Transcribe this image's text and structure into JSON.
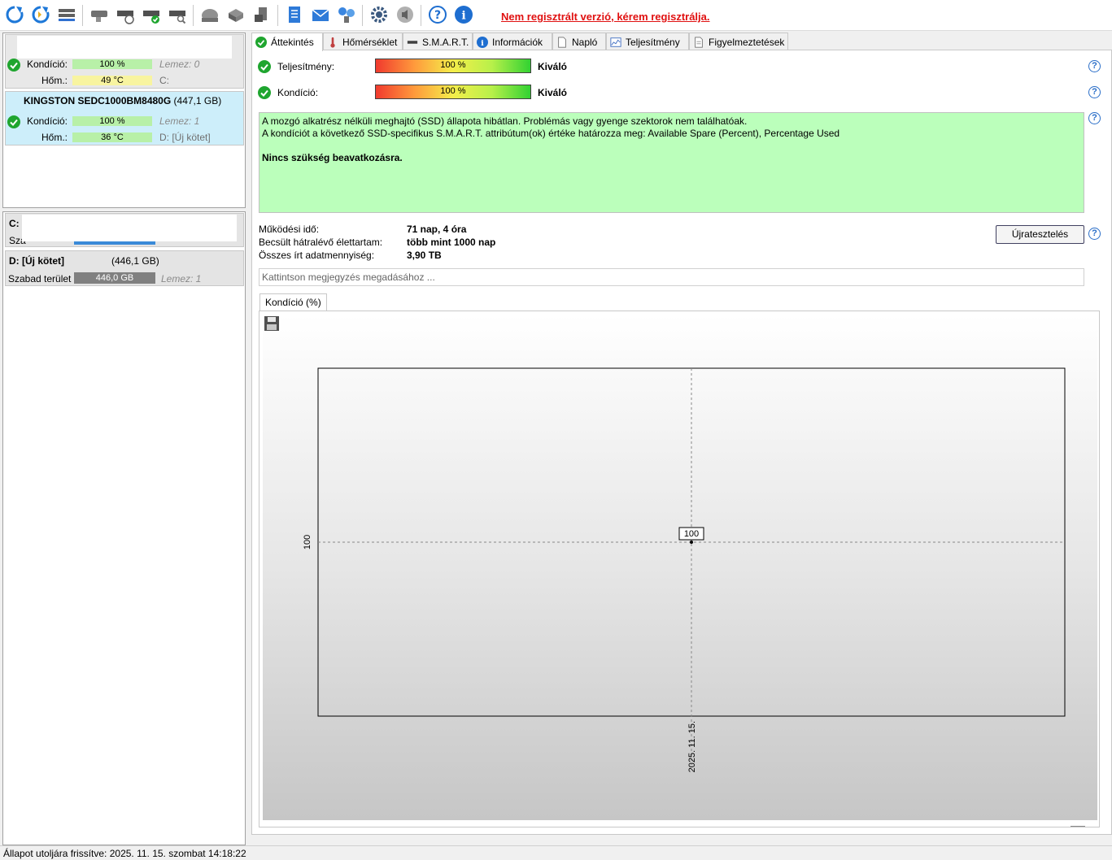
{
  "toolbar": {
    "unregistered_notice": "Nem regisztrált verzió, kérem regisztrálja.",
    "icons": [
      "refresh-icon",
      "refresh-all-icon",
      "drive-list-icon",
      "disk-icon",
      "disk-schedule-icon",
      "disk-check-icon",
      "disk-search-icon",
      "cloud-disk-icon",
      "network-disk-icon",
      "external-disk-icon",
      "notes-icon",
      "mail-icon",
      "network-icon",
      "settings-icon",
      "speaker-icon",
      "help-icon",
      "info-icon"
    ]
  },
  "disks": [
    {
      "condition_label": "Kondíció:",
      "condition_value": "100 %",
      "temp_label": "Hőm.:",
      "temp_value": "49 °C",
      "disk_index": "Lemez: 0",
      "volume": "C:"
    },
    {
      "name": "KINGSTON SEDC1000BM8480G",
      "capacity": "(447,1 GB)",
      "condition_label": "Kondíció:",
      "condition_value": "100 %",
      "temp_label": "Hőm.:",
      "temp_value": "36 °C",
      "disk_index": "Lemez: 1",
      "volume": "D: [Új kötet]"
    }
  ],
  "volumes": [
    {
      "name": "C:",
      "free_label": "Sza"
    },
    {
      "name": "D: [Új kötet]",
      "size": "(446,1 GB)",
      "free_label": "Szabad terület",
      "free_value": "446,0 GB",
      "disk_index": "Lemez: 1"
    }
  ],
  "tabs": [
    {
      "label": "Áttekintés",
      "active": true
    },
    {
      "label": "Hőmérséklet"
    },
    {
      "label": "S.M.A.R.T."
    },
    {
      "label": "Információk"
    },
    {
      "label": "Napló"
    },
    {
      "label": "Teljesítmény"
    },
    {
      "label": "Figyelmeztetések"
    }
  ],
  "overview": {
    "performance_label": "Teljesítmény:",
    "performance_value": "100 %",
    "performance_percent": 100,
    "performance_rating": "Kiváló",
    "condition_label": "Kondíció:",
    "condition_value": "100 %",
    "condition_percent": 100,
    "condition_rating": "Kiváló",
    "status_line1": "A mozgó alkatrész nélküli meghajtó (SSD) állapota hibátlan. Problémás vagy gyenge szektorok nem találhatóak.",
    "status_line2": "A kondíciót a következő SSD-specifikus S.M.A.R.T. attribútum(ok) értéke határozza meg:  Available Spare (Percent), Percentage Used",
    "status_line3": "Nincs szükség beavatkozásra.",
    "uptime_label": "Működési idő:",
    "uptime_value": "71 nap, 4 óra",
    "remaining_label": "Becsült hátralévő élettartam:",
    "remaining_value": "több mint 1000 nap",
    "written_label": "Összes írt adatmennyiség:",
    "written_value": "3,90 TB",
    "retest_button": "Újratesztelés",
    "note_placeholder": "Kattintson megjegyzés megadásához ...",
    "help": "?"
  },
  "chart_tab_label": "Kondíció  (%)",
  "chart_data": {
    "type": "line",
    "x": [
      "2025. 11. 15."
    ],
    "series": [
      {
        "values": [
          100
        ]
      }
    ],
    "y_tick_labels": [
      "100"
    ],
    "x_tick_labels": [
      "2025. 11. 15."
    ],
    "point_labels": [
      "100"
    ],
    "grid": true
  },
  "statusbar": {
    "text": "Állapot utoljára frissítve: 2025. 11. 15. szombat 14:18:22"
  },
  "colors": {
    "accent_blue": "#2a6ec8",
    "ok_green": "#1fa52f",
    "status_bg": "#bbffbb",
    "warning_red": "#e01010"
  }
}
